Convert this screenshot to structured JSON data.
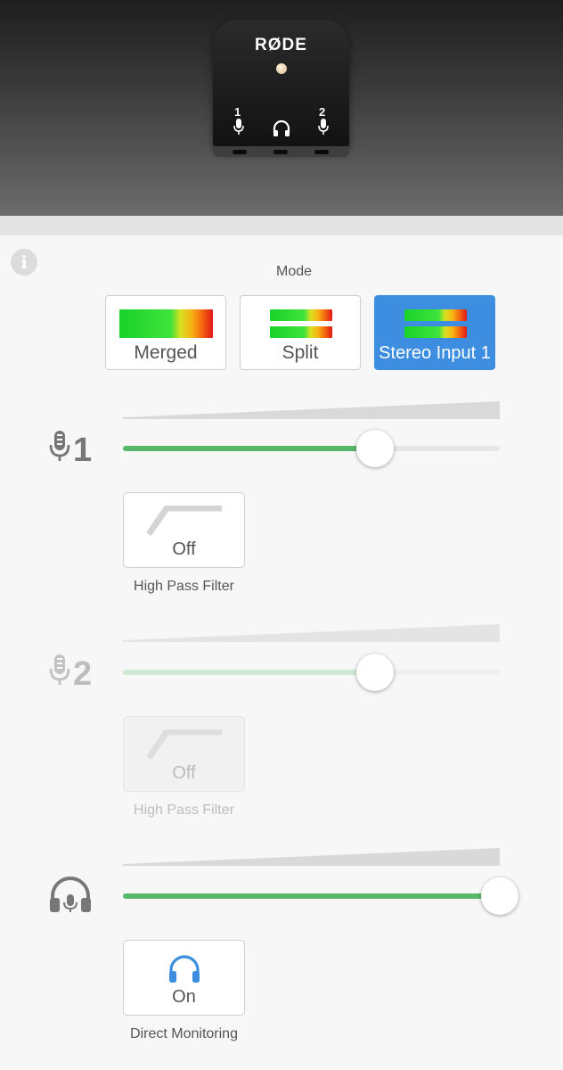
{
  "device": {
    "brand": "RØDE",
    "input1_number": "1",
    "input2_number": "2"
  },
  "mode": {
    "label": "Mode",
    "options": [
      "Merged",
      "Split",
      "Stereo Input 1"
    ],
    "selected": "Stereo Input 1"
  },
  "channel1": {
    "number": "1",
    "level": 0.67,
    "filter_state": "Off",
    "filter_caption": "High Pass Filter",
    "enabled": true
  },
  "channel2": {
    "number": "2",
    "level": 0.67,
    "filter_state": "Off",
    "filter_caption": "High Pass Filter",
    "enabled": false
  },
  "headphones": {
    "level": 1.0,
    "monitoring_state": "On",
    "monitoring_caption": "Direct Monitoring"
  },
  "colors": {
    "accent": "#3d8ee0",
    "slider_fill": "#57b86a"
  }
}
